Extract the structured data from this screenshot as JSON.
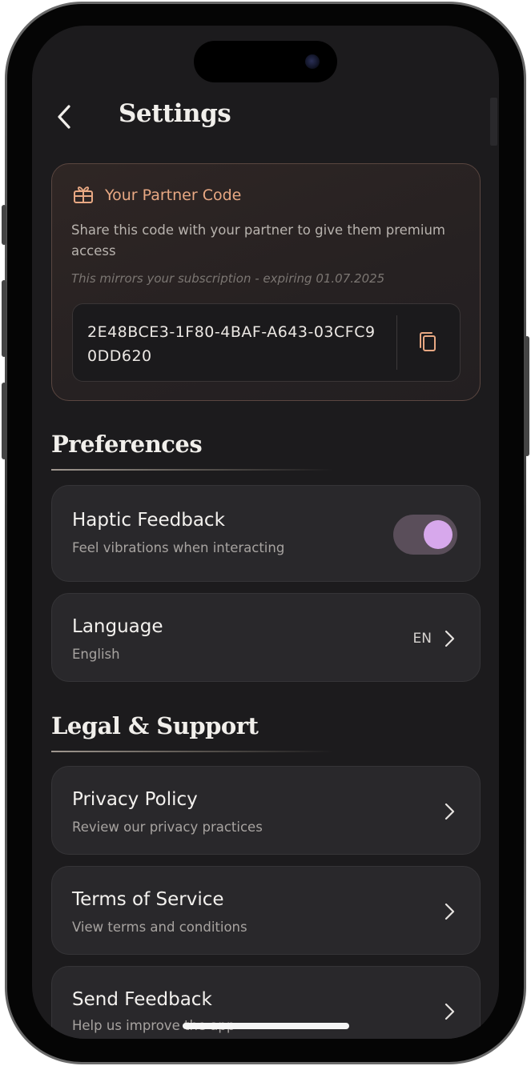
{
  "header": {
    "title": "Settings"
  },
  "partner": {
    "title": "Your Partner Code",
    "description": "Share this code with your partner to give them premium access",
    "note": "This mirrors your subscription - expiring 01.07.2025",
    "code": "2E48BCE3-1F80-4BAF-A643-03CFC90DD620"
  },
  "preferences": {
    "heading": "Preferences",
    "haptic": {
      "title": "Haptic Feedback",
      "subtitle": "Feel vibrations when interacting",
      "enabled": true
    },
    "language": {
      "title": "Language",
      "subtitle": "English",
      "value": "EN"
    }
  },
  "legal": {
    "heading": "Legal & Support",
    "privacy": {
      "title": "Privacy Policy",
      "subtitle": "Review our privacy practices"
    },
    "terms": {
      "title": "Terms of Service",
      "subtitle": "View terms and conditions"
    },
    "feedback": {
      "title": "Send Feedback",
      "subtitle": "Help us improve the app"
    }
  },
  "colors": {
    "background": "#1c1b1d",
    "card": "#29282b",
    "accent_orange": "#e8a883",
    "toggle_knob": "#d7a8ec"
  },
  "icons": {
    "back": "chevron-left-icon",
    "gift": "gift-icon",
    "copy": "copy-icon",
    "chevron": "chevron-right-icon"
  }
}
